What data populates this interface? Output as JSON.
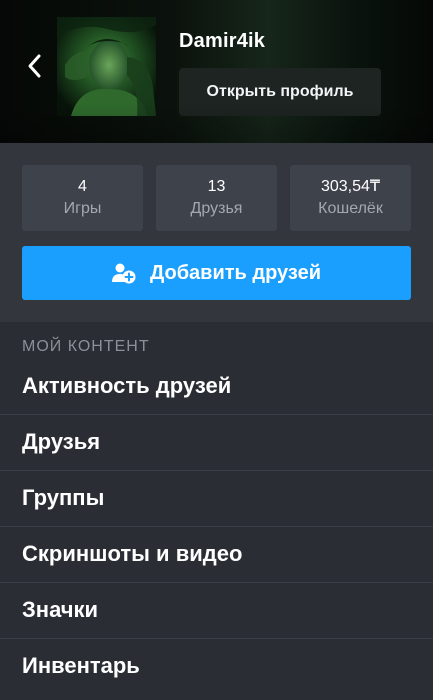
{
  "profile": {
    "username": "Damir4ik",
    "open_profile_label": "Открыть профиль"
  },
  "stats": [
    {
      "value": "4",
      "label": "Игры"
    },
    {
      "value": "13",
      "label": "Друзья"
    },
    {
      "value": "303,54₸",
      "label": "Кошелёк"
    }
  ],
  "add_friends_label": "Добавить друзей",
  "content": {
    "section_title": "МОЙ КОНТЕНТ",
    "items": [
      {
        "label": "Активность друзей"
      },
      {
        "label": "Друзья"
      },
      {
        "label": "Группы"
      },
      {
        "label": "Скриншоты и видео"
      },
      {
        "label": "Значки"
      },
      {
        "label": "Инвентарь"
      }
    ]
  },
  "colors": {
    "accent": "#1a9fff",
    "background": "#2a2d34",
    "stats_background": "#33363d",
    "card": "#3e424b"
  },
  "icons": {
    "back": "chevron-left-icon",
    "add_friend": "user-plus-icon"
  }
}
